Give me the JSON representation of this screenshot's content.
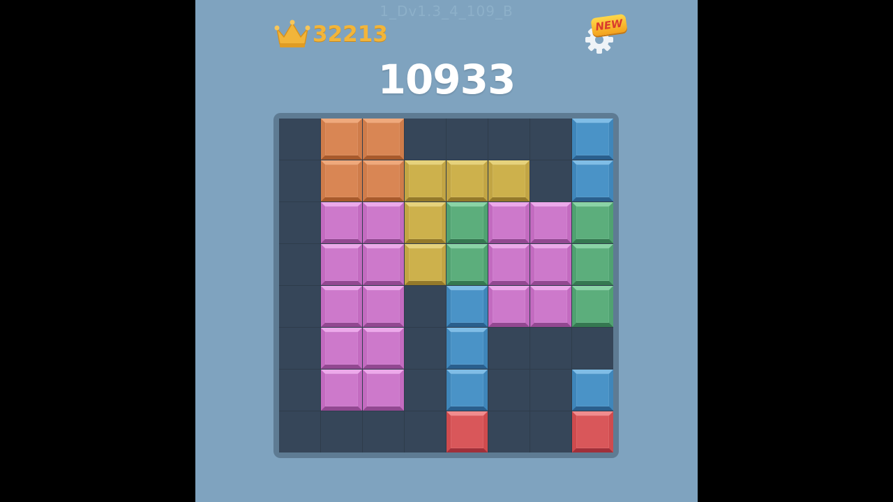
{
  "header": {
    "version": "1_Dv1.3_4_109_B",
    "best_score": "32213",
    "current_score": "10933",
    "new_badge": "NEW"
  },
  "icons": {
    "best": "crown-icon",
    "settings": "gear-icon"
  },
  "colors": {
    "background": "#7fa3bf",
    "board": "#2e3c4b",
    "empty_cell": "#364659",
    "best_score": "#f2b53a"
  },
  "palette": {
    "orange": {
      "c": "#d98654",
      "l": "#efa97c",
      "m": "#cf7c4a",
      "d": "#a85a2c"
    },
    "yellow": {
      "c": "#cdb14c",
      "l": "#e6d27c",
      "m": "#c2a544",
      "d": "#94792a"
    },
    "blue": {
      "c": "#4a93c7",
      "l": "#80bde6",
      "m": "#3f86ba",
      "d": "#2a5f8d"
    },
    "pink": {
      "c": "#cd79cb",
      "l": "#eca9ea",
      "m": "#c36bc0",
      "d": "#924891"
    },
    "green": {
      "c": "#5cae7c",
      "l": "#8ad3a6",
      "m": "#50a271",
      "d": "#357851"
    },
    "red": {
      "c": "#d9575a",
      "l": "#f08c8e",
      "m": "#cf4b4e",
      "d": "#a0303a"
    }
  },
  "board": {
    "rows": 8,
    "cols": 8,
    "cells": [
      [
        null,
        "orange",
        "orange",
        null,
        null,
        null,
        null,
        "blue"
      ],
      [
        null,
        "orange",
        "orange",
        "yellow",
        "yellow",
        "yellow",
        null,
        "blue"
      ],
      [
        null,
        "pink",
        "pink",
        "yellow",
        "green",
        "pink",
        "pink",
        "green"
      ],
      [
        null,
        "pink",
        "pink",
        "yellow",
        "green",
        "pink",
        "pink",
        "green"
      ],
      [
        null,
        "pink",
        "pink",
        null,
        "blue",
        "pink",
        "pink",
        "green"
      ],
      [
        null,
        "pink",
        "pink",
        null,
        "blue",
        null,
        null,
        null
      ],
      [
        null,
        "pink",
        "pink",
        null,
        "blue",
        null,
        null,
        "blue"
      ],
      [
        null,
        null,
        null,
        null,
        "red",
        null,
        null,
        "red"
      ]
    ]
  }
}
